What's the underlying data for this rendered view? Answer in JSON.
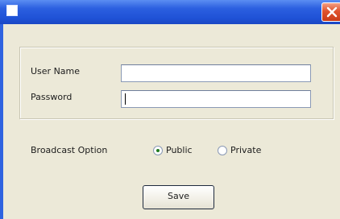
{
  "window": {
    "title": "",
    "accent_color": "#2b5fe0",
    "close_color": "#e0522d"
  },
  "credentials": {
    "username_label": "User Name",
    "username_value": "",
    "password_label": "Password",
    "password_value": ""
  },
  "broadcast": {
    "label": "Broadcast Option",
    "options": [
      {
        "label": "Public",
        "selected": true
      },
      {
        "label": "Private",
        "selected": false
      }
    ]
  },
  "actions": {
    "save_label": "Save"
  },
  "icons": {
    "system": "window-icon",
    "close": "close-icon",
    "radio_selected": "radio-selected-icon",
    "radio_unselected": "radio-unselected-icon"
  }
}
